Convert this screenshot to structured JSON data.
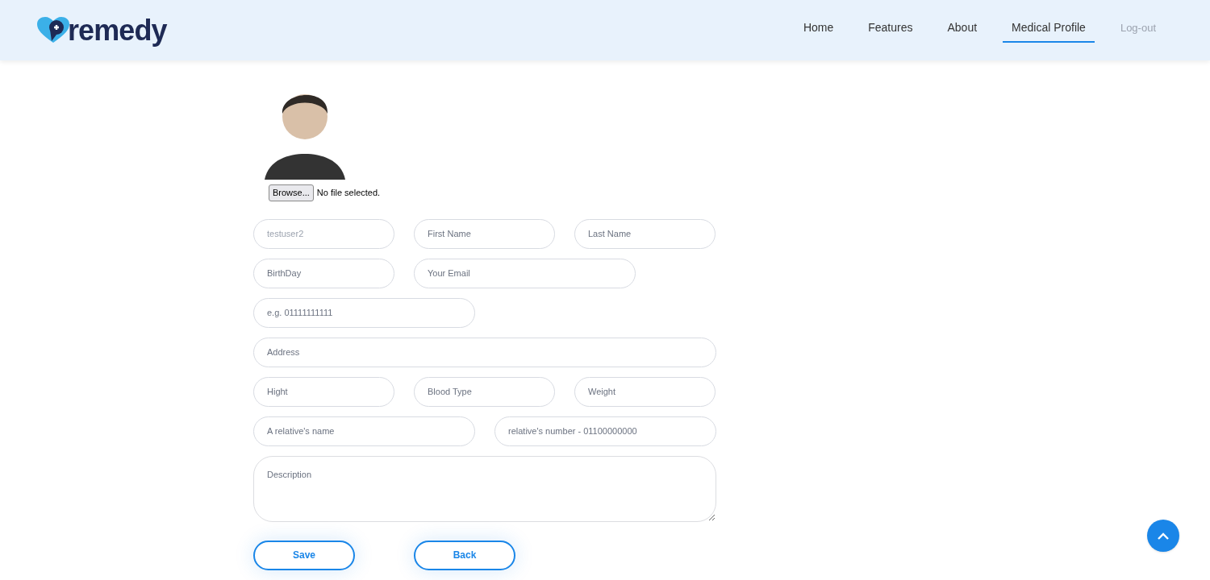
{
  "header": {
    "logo": "remedy",
    "nav": [
      {
        "label": "Home",
        "kind": "link",
        "selected": false
      },
      {
        "label": "Features",
        "kind": "link",
        "selected": false
      },
      {
        "label": "About",
        "kind": "link",
        "selected": false
      },
      {
        "label": "Medical Profile",
        "kind": "link",
        "selected": true
      },
      {
        "label": "Log-out",
        "kind": "logout",
        "selected": false
      }
    ]
  },
  "file_picker": {
    "button": "Browse...",
    "status": "No file selected."
  },
  "form_rows": [
    [
      {
        "value": "testuser2",
        "disabled": true
      },
      {
        "placeholder": "First Name"
      },
      {
        "placeholder": "Last Name"
      }
    ],
    [
      {
        "placeholder": "BirthDay"
      },
      {
        "placeholder": "Your Email"
      }
    ],
    [
      {
        "placeholder": "e.g. 01111111111"
      }
    ],
    [
      {
        "placeholder": "Address"
      }
    ],
    [
      {
        "placeholder": "Hight"
      },
      {
        "placeholder": "Blood Type"
      },
      {
        "placeholder": "Weight"
      }
    ],
    [
      {
        "placeholder": "A relative's name"
      },
      {
        "placeholder": "relative's number - 01100000000"
      }
    ]
  ],
  "description": {
    "placeholder": "Description"
  },
  "buttons": [
    "Save",
    "Back"
  ]
}
